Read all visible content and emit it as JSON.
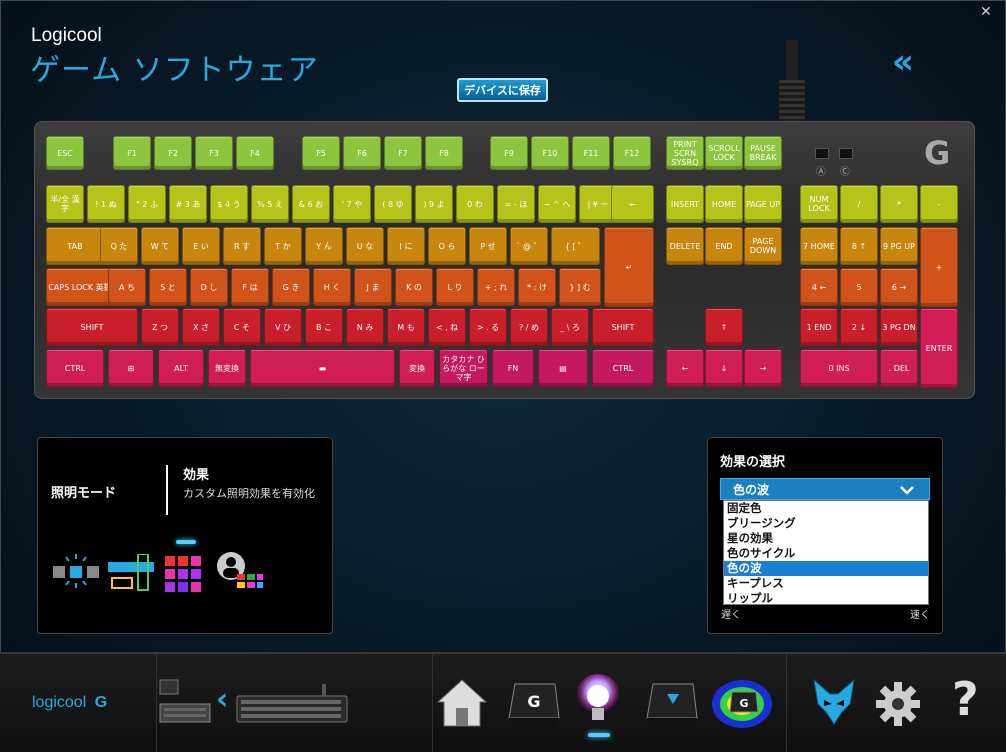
{
  "window": {
    "close_glyph": "✕"
  },
  "header": {
    "brand": "Logicool",
    "title": "ゲーム ソフトウェア",
    "back_glyph": "«",
    "save_button": "デバイスに保存"
  },
  "keyboard": {
    "logo_glyph": "G",
    "led_labels": [
      "Ⓐ",
      "Ⓒ"
    ],
    "colors": {
      "green": "#8cc63e",
      "lime": "#b6c419",
      "ochre": "#c8860f",
      "orange": "#d0531a",
      "red": "#c81f2a",
      "crimson": "#d11d55",
      "magenta": "#c4195e"
    },
    "rows": [
      {
        "color": "green",
        "keys": [
          "ESC",
          "F1",
          "F2",
          "F3",
          "F4",
          "F5",
          "F6",
          "F7",
          "F8",
          "F9",
          "F10",
          "F11",
          "F12",
          "PRINT SCRN SYSRQ",
          "SCROLL LOCK",
          "PAUSE BREAK"
        ]
      },
      {
        "color": "lime",
        "keys": [
          "半/全 漢字",
          "! 1 ぬ",
          "\" 2 ふ",
          "# 3 あ",
          "$ 4 う",
          "% 5 え",
          "& 6 お",
          "' 7 や",
          "( 8 ゆ",
          ") 9 よ",
          "0 わ",
          "= - ほ",
          "~ ^ へ",
          "| ¥ ー",
          "←",
          "INSERT",
          "HOME",
          "PAGE UP",
          "NUM LOCK",
          "/",
          "*",
          "-"
        ]
      },
      {
        "color": "ochre",
        "keys": [
          "TAB",
          "Q た",
          "W て",
          "E い",
          "R す",
          "T か",
          "Y ん",
          "U な",
          "I に",
          "O ら",
          "P せ",
          "` @ ゛",
          "{ [ ゜",
          "↵",
          "DELETE",
          "END",
          "PAGE DOWN",
          "7 HOME",
          "8 ↑",
          "9 PG UP",
          "+"
        ]
      },
      {
        "color": "orange",
        "keys": [
          "CAPS LOCK 英数",
          "A ち",
          "S と",
          "D し",
          "F は",
          "G き",
          "H く",
          "J ま",
          "K の",
          "L り",
          "+ ; れ",
          "* : け",
          "} ] む",
          "4 ←",
          "5",
          "6 →"
        ]
      },
      {
        "color": "red",
        "keys": [
          "SHIFT",
          "Z つ",
          "X さ",
          "C そ",
          "V ひ",
          "B こ",
          "N み",
          "M も",
          "< , ね",
          "> . る",
          "? / め",
          "_ \\ ろ",
          "SHIFT",
          "↑",
          "1 END",
          "2 ↓",
          "3 PG DN",
          "ENTER"
        ]
      },
      {
        "color": "crimson",
        "keys": [
          "CTRL",
          "⊞",
          "ALT",
          "無変換",
          "▬",
          "変換",
          "カタカナ ひらがな ローマ字",
          "FN",
          "▤",
          "CTRL",
          "←",
          "↓",
          "→",
          "0 INS",
          ". DEL"
        ]
      }
    ]
  },
  "lighting_panel": {
    "mode_label": "照明モード",
    "effect_title": "効果",
    "effect_desc": "カスタム照明効果を有効化"
  },
  "effect_panel": {
    "title": "効果の選択",
    "selected": "色の波",
    "options": [
      "固定色",
      "ブリージング",
      "星の効果",
      "色のサイクル",
      "色の波",
      "キープレス",
      "リップル"
    ],
    "selected_index": 4,
    "slow": "遅く",
    "fast": "速く"
  },
  "bottom": {
    "logo_text": "logicool",
    "logo_glyph": "G",
    "nav_prev": "‹",
    "help_glyph": "?"
  }
}
